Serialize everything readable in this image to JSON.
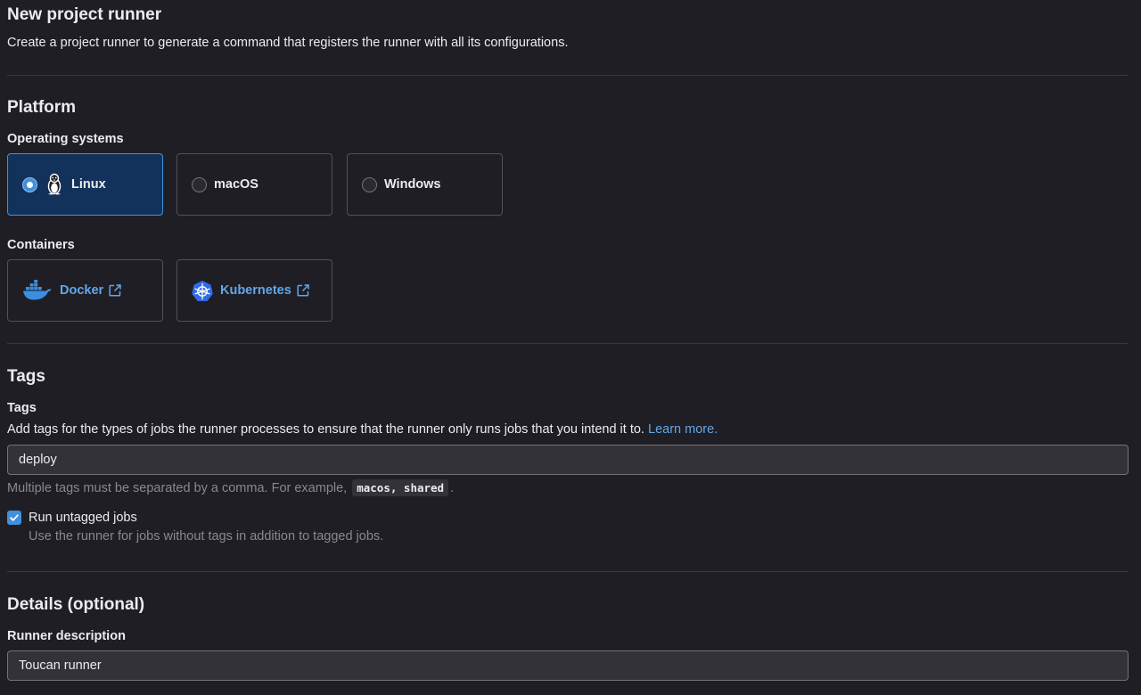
{
  "page": {
    "title": "New project runner",
    "subtitle": "Create a project runner to generate a command that registers the runner with all its configurations."
  },
  "platform": {
    "heading": "Platform",
    "os_label": "Operating systems",
    "os_options": [
      {
        "label": "Linux",
        "selected": true,
        "icon": "linux-tux-icon"
      },
      {
        "label": "macOS",
        "selected": false
      },
      {
        "label": "Windows",
        "selected": false
      }
    ],
    "containers_label": "Containers",
    "containers": [
      {
        "label": "Docker",
        "icon": "docker-icon"
      },
      {
        "label": "Kubernetes",
        "icon": "kubernetes-icon"
      }
    ]
  },
  "tags": {
    "heading": "Tags",
    "label": "Tags",
    "description": "Add tags for the types of jobs the runner processes to ensure that the runner only runs jobs that you intend it to.",
    "learn_more": "Learn more.",
    "input_value": "deploy",
    "help_prefix": "Multiple tags must be separated by a comma. For example,",
    "help_example": "macos, shared",
    "help_suffix": ".",
    "run_untagged_label": "Run untagged jobs",
    "run_untagged_checked": true,
    "run_untagged_help": "Use the runner for jobs without tags in addition to tagged jobs."
  },
  "details": {
    "heading": "Details (optional)",
    "description_label": "Runner description",
    "description_value": "Toucan runner"
  },
  "colors": {
    "background": "#1f1e24",
    "selected_card": "#13325b",
    "accent": "#428fdc",
    "link": "#63a6e9"
  }
}
